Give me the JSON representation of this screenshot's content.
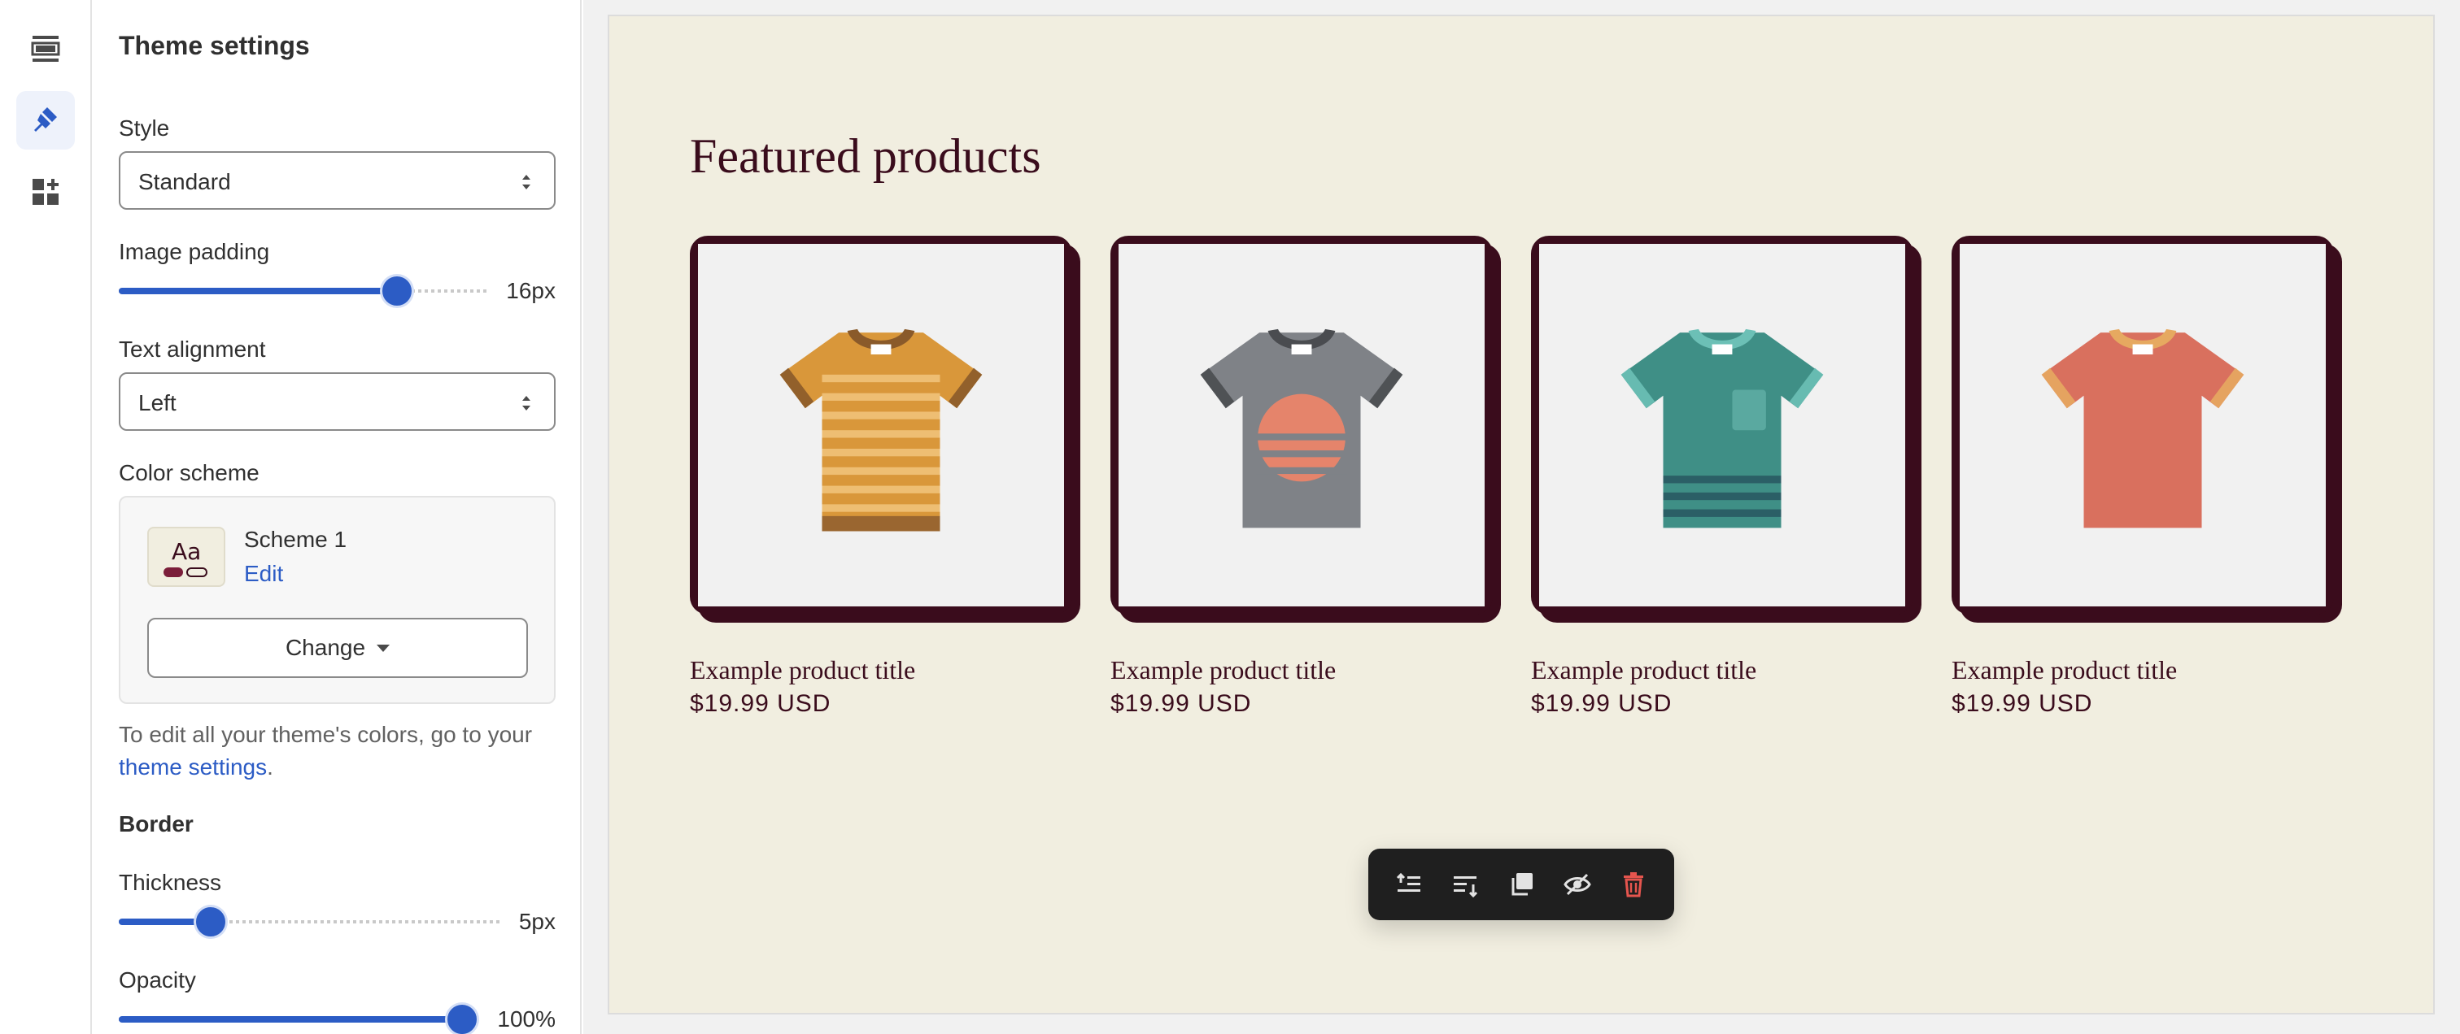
{
  "panel": {
    "title": "Theme settings",
    "style_label": "Style",
    "style_value": "Standard",
    "padding_label": "Image padding",
    "padding_value": "16px",
    "padding_fraction": 0.78,
    "alignment_label": "Text alignment",
    "alignment_value": "Left",
    "color_label": "Color scheme",
    "scheme_preview": "Aa",
    "scheme_name": "Scheme 1",
    "scheme_edit": "Edit",
    "change_label": "Change",
    "help_text": "To edit all your theme's colors, go to your",
    "help_link": "theme settings",
    "help_end": ".",
    "border_heading": "Border",
    "thickness_label": "Thickness",
    "thickness_value": "5px",
    "thickness_fraction": 0.22,
    "opacity_label": "Opacity",
    "opacity_value": "100%",
    "opacity_fraction": 1.0
  },
  "rail": {
    "items": [
      {
        "icon": "sections-icon"
      },
      {
        "icon": "paint-brush-icon",
        "active": true
      },
      {
        "icon": "add-app-block-icon"
      }
    ]
  },
  "preview": {
    "heading": "Featured products",
    "products": [
      {
        "title": "Example product title",
        "price": "$19.99 USD",
        "shirt_color": "#d9973a",
        "collar": "#8a5a2a",
        "pattern": "stripes"
      },
      {
        "title": "Example product title",
        "price": "$19.99 USD",
        "shirt_color": "#7f8287",
        "collar": "#4a4c50",
        "pattern": "sunset"
      },
      {
        "title": "Example product title",
        "price": "$19.99 USD",
        "shirt_color": "#3f8f86",
        "collar": "#6cc0b6",
        "pattern": "pocket"
      },
      {
        "title": "Example product title",
        "price": "$19.99 USD",
        "shirt_color": "#d9705e",
        "collar": "#e6a960",
        "pattern": "plain"
      }
    ],
    "toolbar": [
      "move-up-icon",
      "move-down-icon",
      "duplicate-icon",
      "hide-icon",
      "delete-icon"
    ]
  },
  "colors": {
    "accent": "#2c5cc5",
    "canvas": "#f1eee0",
    "brand_dark": "#3a0c1c",
    "danger": "#e5554e"
  }
}
